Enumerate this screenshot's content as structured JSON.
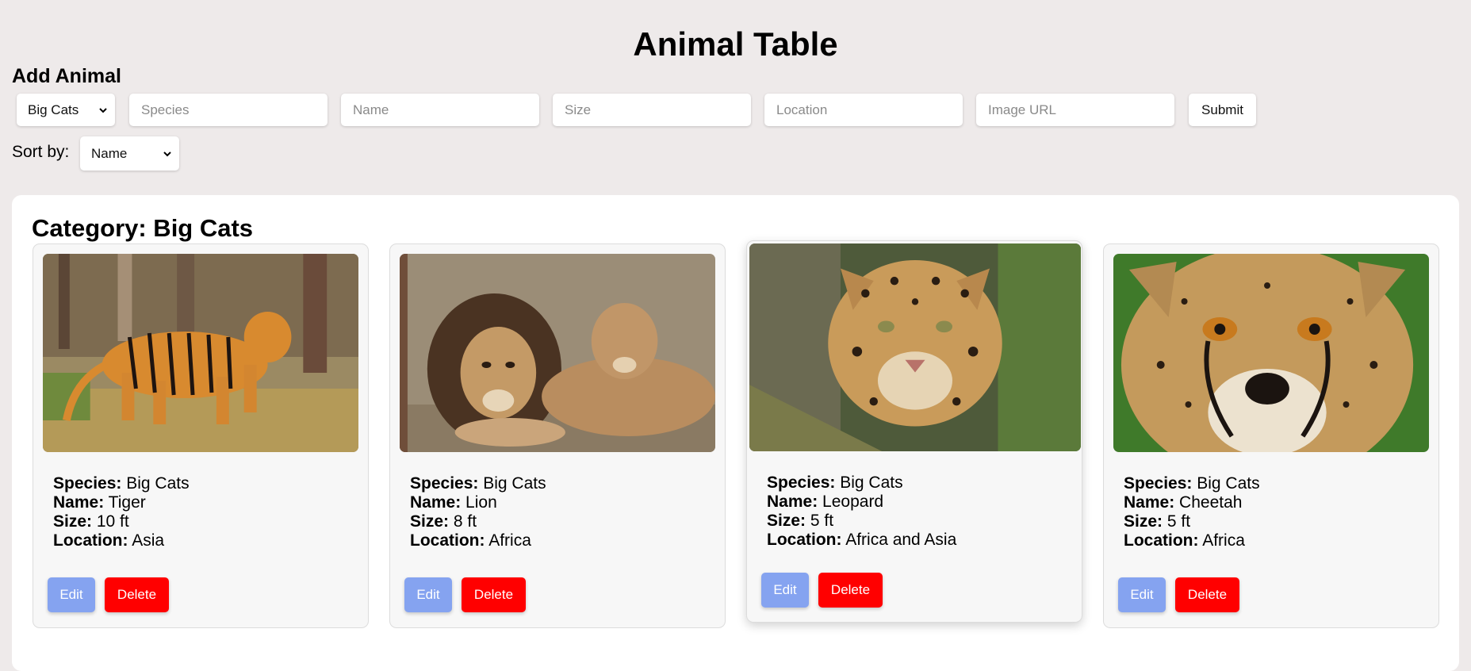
{
  "page_title": "Animal Table",
  "form": {
    "heading": "Add Animal",
    "category_selected": "Big Cats",
    "species_placeholder": "Species",
    "name_placeholder": "Name",
    "size_placeholder": "Size",
    "location_placeholder": "Location",
    "image_url_placeholder": "Image URL",
    "submit_label": "Submit"
  },
  "sort": {
    "label": "Sort by:",
    "selected": "Name"
  },
  "category": {
    "title": "Category: Big Cats",
    "field_labels": {
      "species": "Species:",
      "name": "Name:",
      "size": "Size:",
      "location": "Location:"
    },
    "edit_label": "Edit",
    "delete_label": "Delete",
    "cards": [
      {
        "species": "Big Cats",
        "name": "Tiger",
        "size": "10 ft",
        "location": "Asia",
        "image_icon": "tiger-image"
      },
      {
        "species": "Big Cats",
        "name": "Lion",
        "size": "8 ft",
        "location": "Africa",
        "image_icon": "lion-image"
      },
      {
        "species": "Big Cats",
        "name": "Leopard",
        "size": "5 ft",
        "location": "Africa and Asia",
        "image_icon": "leopard-image"
      },
      {
        "species": "Big Cats",
        "name": "Cheetah",
        "size": "5 ft",
        "location": "Africa",
        "image_icon": "cheetah-image"
      }
    ]
  },
  "colors": {
    "background": "#eeeaea",
    "edit_button": "#85a3f0",
    "delete_button": "#ff0000"
  }
}
